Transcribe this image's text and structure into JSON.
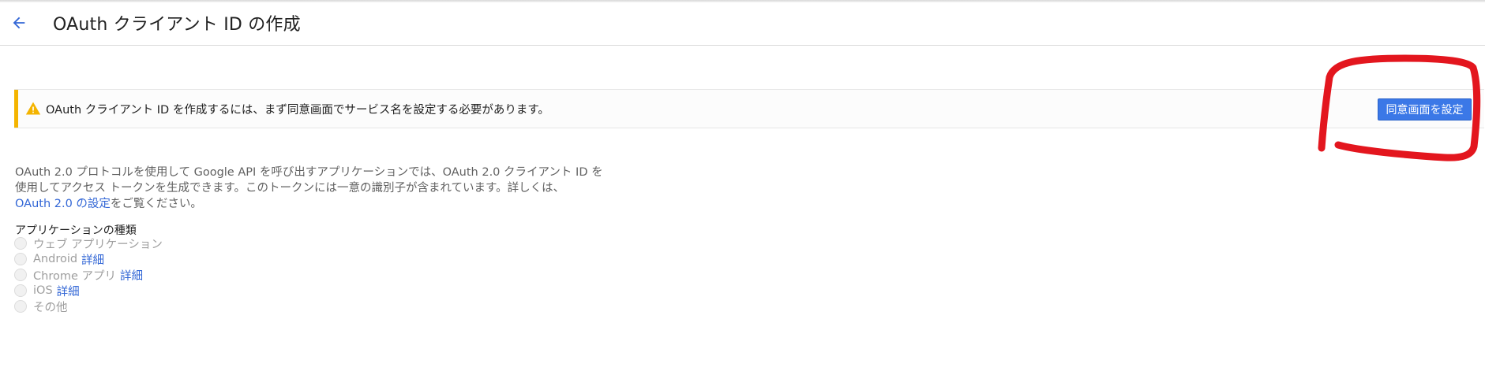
{
  "header": {
    "title": "OAuth クライアント ID の作成",
    "back_icon": "arrow-back-icon"
  },
  "warning": {
    "icon": "warning-icon",
    "message": "OAuth クライアント ID を作成するには、まず同意画面でサービス名を設定する必要があります。",
    "button_label": "同意画面を設定"
  },
  "description": {
    "line1": "OAuth 2.0 プロトコルを使用して Google API を呼び出すアプリケーションでは、OAuth 2.0 クライアント ID を",
    "line2": "使用してアクセス トークンを生成できます。このトークンには一意の識別子が含まれています。詳しくは、",
    "link_text": "OAuth 2.0 の設定",
    "line3_suffix": "をご覧ください。"
  },
  "app_type": {
    "label": "アプリケーションの種類",
    "options": [
      {
        "label": "ウェブ アプリケーション",
        "link": ""
      },
      {
        "label": "Android",
        "link": "詳細"
      },
      {
        "label": "Chrome アプリ",
        "link": "詳細"
      },
      {
        "label": "iOS",
        "link": "詳細"
      },
      {
        "label": "その他",
        "link": ""
      }
    ]
  },
  "colors": {
    "accent_blue": "#3b78e7",
    "link_blue": "#3367d6",
    "warning_yellow": "#f4b400",
    "annotation_red": "#e3161e"
  }
}
